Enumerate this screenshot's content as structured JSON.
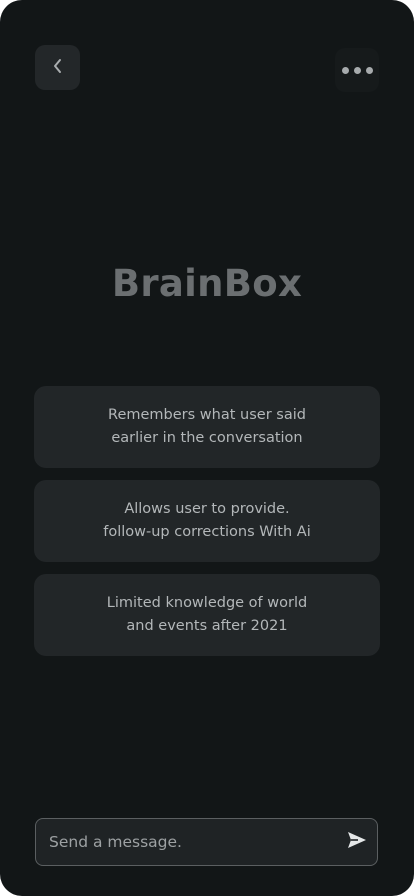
{
  "header": {
    "back_icon": "chevron-left-icon",
    "more_icon": "more-horizontal-icon"
  },
  "title": "BrainBox",
  "features": [
    {
      "line1": "Remembers what user said",
      "line2": "earlier in the conversation"
    },
    {
      "line1": "Allows user to provide.",
      "line2": "follow-up corrections With Ai"
    },
    {
      "line1": "Limited knowledge of world",
      "line2": "and events after 2021"
    }
  ],
  "composer": {
    "placeholder": "Send a message.",
    "value": "",
    "send_icon": "send-icon"
  },
  "colors": {
    "background": "#121617",
    "card": "#222628",
    "title": "#6b6f71",
    "text": "#b3b7b9",
    "border": "#5b5f61"
  }
}
